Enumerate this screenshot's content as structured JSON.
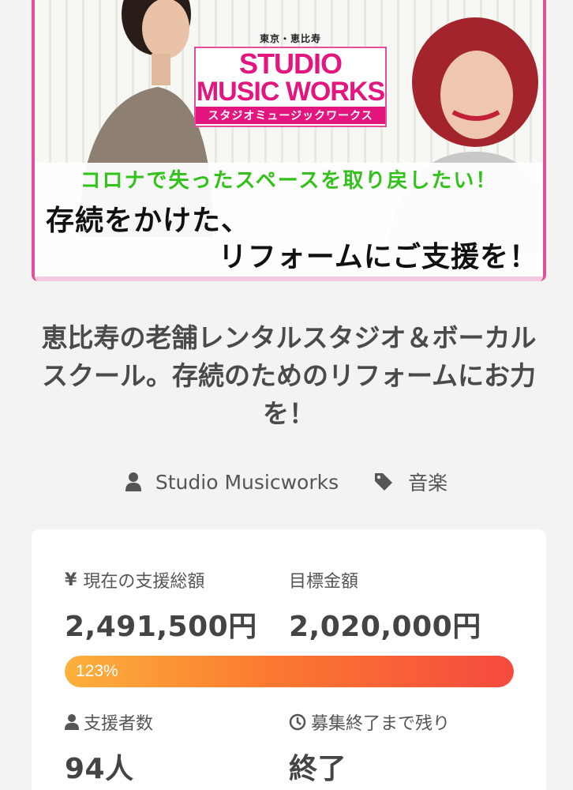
{
  "hero": {
    "logo_location": "東京・恵比寿",
    "logo_line1": "STUDIO",
    "logo_line2": "MUSIC WORKS",
    "logo_kana": "スタジオミュージックワークス",
    "tagline_green": "コロナで失ったスペースを取り戻したい！",
    "headline1": "存続をかけた、",
    "headline2": "リフォームにご支援を！",
    "brand_color": "#e3157f",
    "accent_green": "#33c21b"
  },
  "project": {
    "title": "恵比寿の老舗レンタルスタジオ＆ボーカルスクール。存続のためのリフォームにお力を！",
    "owner": "Studio Musicworks",
    "owner_icon": "user-icon",
    "category": "音楽",
    "category_icon": "tag-icon"
  },
  "stats": {
    "current_label": "現在の支援総額",
    "current_icon": "yen-icon",
    "current_value": "2,491,500円",
    "goal_label": "目標金額",
    "goal_value": "2,020,000円",
    "progress_text": "123%",
    "progress_fraction": 1.0,
    "backers_label": "支援者数",
    "backers_icon": "user-icon",
    "backers_value": "94人",
    "remaining_label": "募集終了まで残り",
    "remaining_icon": "clock-icon",
    "remaining_value": "終了"
  }
}
